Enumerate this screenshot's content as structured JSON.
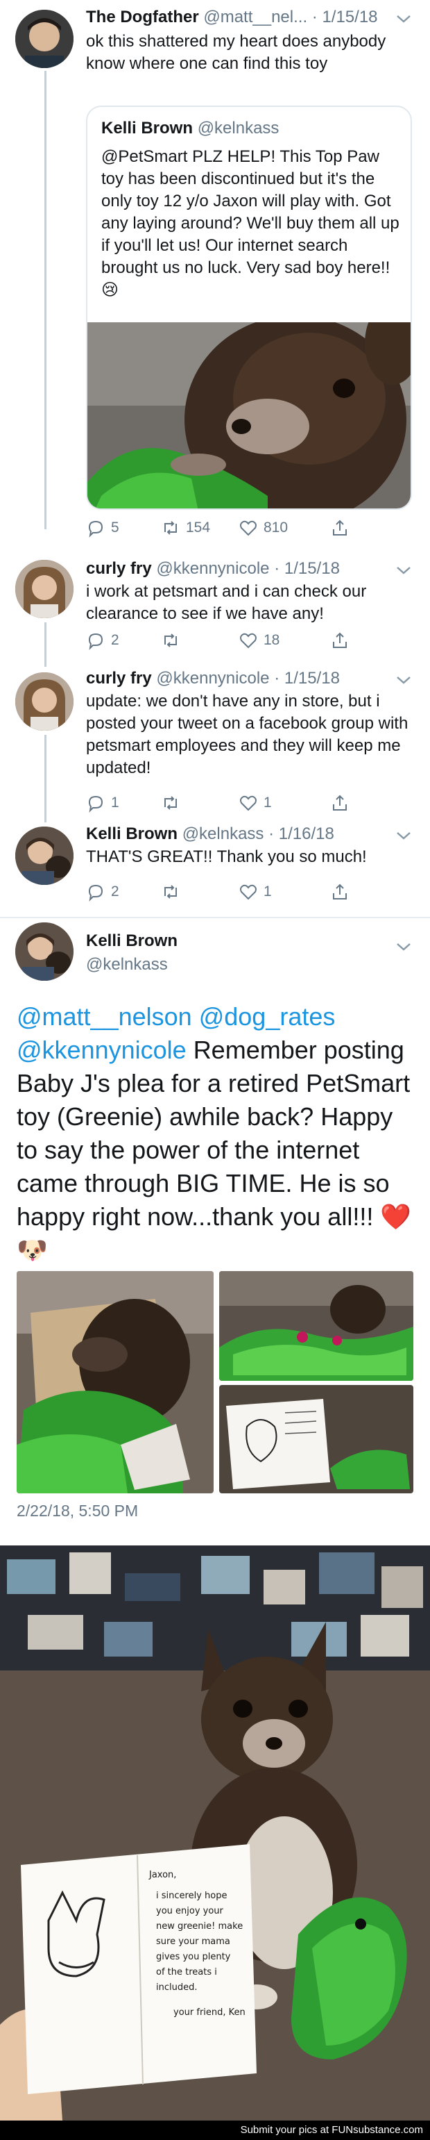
{
  "tweet1": {
    "name": "The Dogfather",
    "handle": "@matt__nel...",
    "date": "· 1/15/18",
    "text": "ok this shattered my heart does anybody know where one can find this toy",
    "quote": {
      "name": "Kelli Brown",
      "handle": "@kelnkass",
      "text": "@PetSmart PLZ HELP! This Top Paw toy has been discontinued but it's the only toy 12 y/o Jaxon will play with. Got any laying around? We'll buy them all up if you'll let us! Our internet search brought us no luck. Very sad boy here!! 😢"
    },
    "replies": "5",
    "retweets": "154",
    "likes": "810"
  },
  "tweet2": {
    "name": "curly fry",
    "handle": "@kkennynicole",
    "date": "· 1/15/18",
    "text": "i work at petsmart and i can check our clearance to see if we have any!",
    "replies": "2",
    "retweets": "",
    "likes": "18"
  },
  "tweet3": {
    "name": "curly fry",
    "handle": "@kkennynicole",
    "date": "· 1/15/18",
    "text": "update: we don't have any in store, but i posted your tweet on a facebook group with petsmart employees and they will keep me updated!",
    "replies": "1",
    "retweets": "",
    "likes": "1"
  },
  "tweet4": {
    "name": "Kelli Brown",
    "handle": "@kelnkass",
    "date": "· 1/16/18",
    "text": "THAT'S GREAT!! Thank you so much!",
    "replies": "2",
    "retweets": "",
    "likes": "1"
  },
  "main": {
    "name": "Kelli Brown",
    "handle": "@kelnkass",
    "mention1": "@matt__nelson",
    "mention2": "@dog_rates",
    "mention3": "@kkennynicole",
    "text": "Remember posting Baby J's plea for a retired PetSmart toy (Greenie) awhile back? Happy to say the power of the internet came through BIG TIME. He is so happy right now...thank you all!!! ❤️🐶",
    "timestamp": "2/22/18, 5:50 PM"
  },
  "card": {
    "greeting": "Jaxon,",
    "lines": [
      "i sincerely hope",
      "you enjoy your",
      "new greenie! make",
      "sure your mama",
      "gives you plenty",
      "of the treats i",
      "included."
    ],
    "signoff": "your friend, Ken"
  },
  "footer": "Submit your pics at FUNsubstance.com",
  "colors": {
    "accent": "#1b95e0",
    "muted": "#657786",
    "thread": "#c4cfd6",
    "toy_green": "#2e9e33"
  }
}
